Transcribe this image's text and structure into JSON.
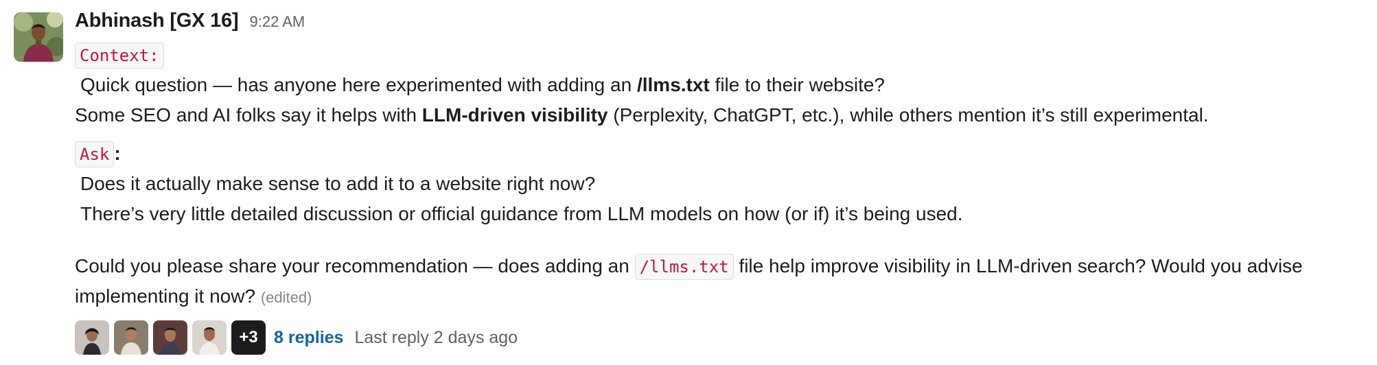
{
  "message": {
    "author": "Abhinash [GX 16]",
    "time": "9:22 AM",
    "context_code": "Context:",
    "line1_pre": "Quick question — has anyone here experimented with adding an ",
    "line1_bold": "/llms.txt",
    "line1_post": " file to their website?",
    "line2_pre": "Some SEO and AI folks say it helps with ",
    "line2_bold": "LLM-driven visibility",
    "line2_post": " (Perplexity, ChatGPT, etc.), while others mention it’s still experimental.",
    "ask_code": "Ask",
    "ask_colon": ":",
    "ask_line1": "Does it actually make sense to add it to a website right now?",
    "ask_line2": "There’s very little detailed discussion or official guidance from LLM models on how (or if) it’s being used.",
    "rec_pre": "Could you please share your recommendation — does adding an ",
    "rec_code": "/llms.txt",
    "rec_post": " file help improve visibility in LLM-driven search? Would you advise",
    "rec_line2": "implementing it now?",
    "edited": "(edited)"
  },
  "thread": {
    "more_count": "+3",
    "replies": "8 replies",
    "last_reply": "Last reply 2 days ago"
  }
}
